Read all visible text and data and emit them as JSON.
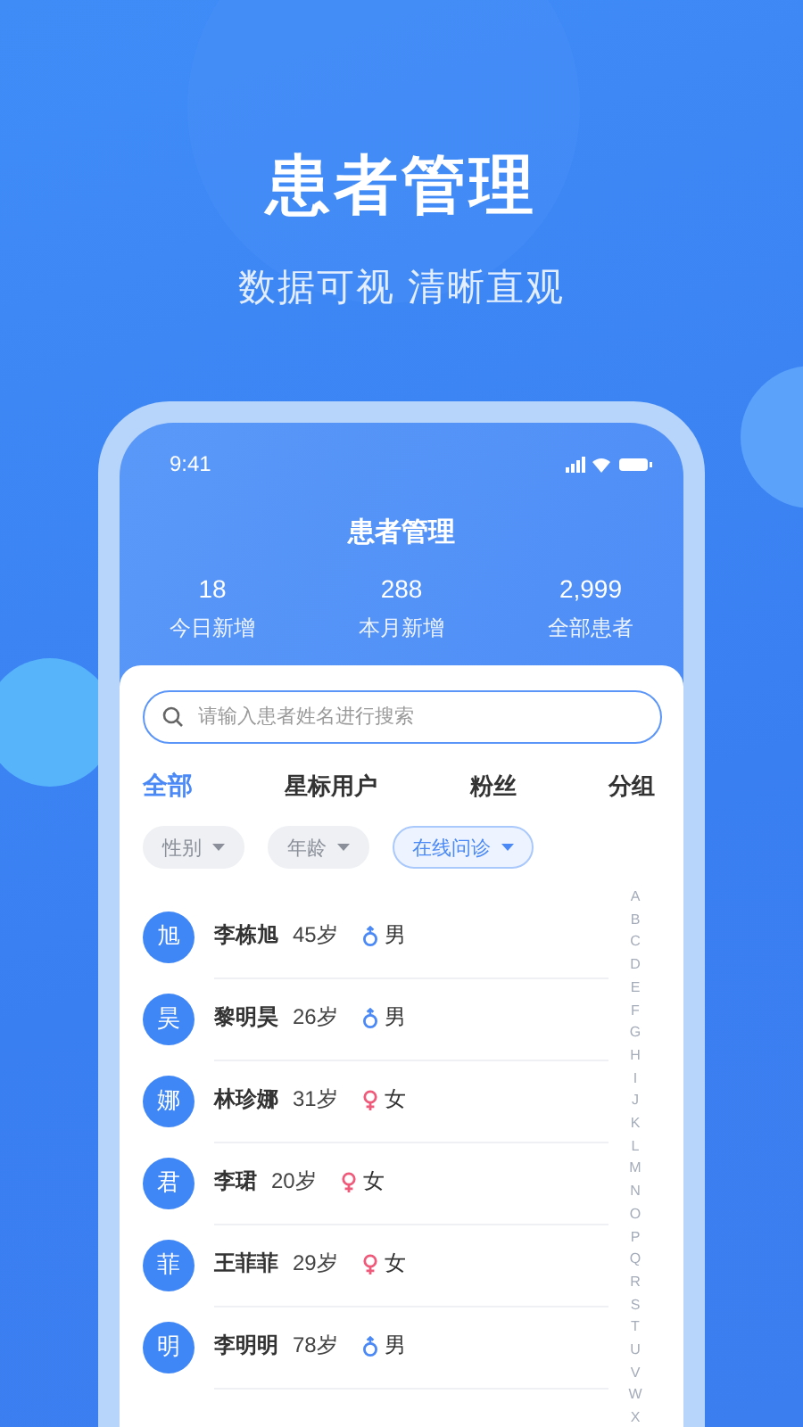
{
  "headline": "患者管理",
  "subtitle": "数据可视 清晰直观",
  "phone": {
    "status_bar": {
      "time": "9:41"
    },
    "title": "患者管理",
    "stats": [
      {
        "value": "18",
        "label": "今日新增"
      },
      {
        "value": "288",
        "label": "本月新增"
      },
      {
        "value": "2,999",
        "label": "全部患者"
      }
    ],
    "search": {
      "placeholder": "请输入患者姓名进行搜索"
    },
    "tabs": [
      {
        "label": "全部",
        "selected": true
      },
      {
        "label": "星标用户",
        "selected": false
      },
      {
        "label": "粉丝",
        "selected": false
      },
      {
        "label": "分组",
        "selected": false
      }
    ],
    "filters": [
      {
        "label": "性别",
        "selected": false
      },
      {
        "label": "年龄",
        "selected": false
      },
      {
        "label": "在线问诊",
        "selected": true
      }
    ],
    "patients": [
      {
        "avatar": "旭",
        "name": "李栋旭",
        "age": "45岁",
        "gender": "男",
        "kind": "male"
      },
      {
        "avatar": "昊",
        "name": "黎明昊",
        "age": "26岁",
        "gender": "男",
        "kind": "male"
      },
      {
        "avatar": "娜",
        "name": "林珍娜",
        "age": "31岁",
        "gender": "女",
        "kind": "female"
      },
      {
        "avatar": "君",
        "name": "李珺",
        "age": "20岁",
        "gender": "女",
        "kind": "female"
      },
      {
        "avatar": "菲",
        "name": "王菲菲",
        "age": "29岁",
        "gender": "女",
        "kind": "female"
      },
      {
        "avatar": "明",
        "name": "李明明",
        "age": "78岁",
        "gender": "男",
        "kind": "male"
      }
    ],
    "index": [
      "A",
      "B",
      "C",
      "D",
      "E",
      "F",
      "G",
      "H",
      "I",
      "J",
      "K",
      "L",
      "M",
      "N",
      "O",
      "P",
      "Q",
      "R",
      "S",
      "T",
      "U",
      "V",
      "W",
      "X"
    ]
  }
}
